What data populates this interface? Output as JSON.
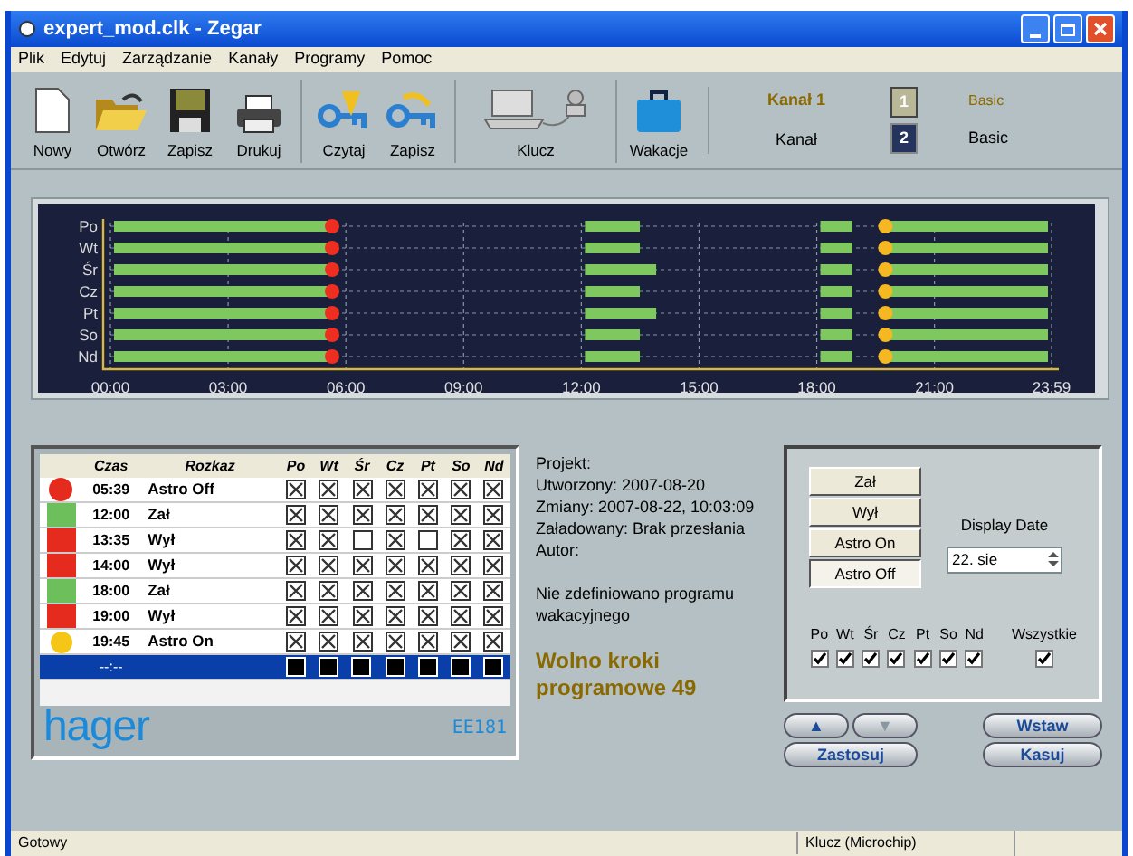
{
  "window": {
    "title": "expert_mod.clk - Zegar"
  },
  "menu": [
    "Plik",
    "Edytuj",
    "Zarządzanie",
    "Kanały",
    "Programy",
    "Pomoc"
  ],
  "toolbar": [
    {
      "label": "Nowy",
      "kind": "new"
    },
    {
      "label": "Otwórz",
      "kind": "open"
    },
    {
      "label": "Zapisz",
      "kind": "save"
    },
    {
      "label": "Drukuj",
      "kind": "print"
    },
    {
      "label": "Czytaj",
      "kind": "key-read"
    },
    {
      "label": "Zapisz",
      "kind": "key-write"
    },
    {
      "label": "Klucz",
      "kind": "computer"
    },
    {
      "label": "Wakacje",
      "kind": "suitcase"
    }
  ],
  "channel": {
    "name": "Kanał 1",
    "label": "Kanał",
    "buttons": [
      {
        "label": "1",
        "selected": true
      },
      {
        "label": "2",
        "selected": false
      }
    ],
    "mode_top": "Basic",
    "mode": "Basic"
  },
  "timeline": {
    "days": [
      "Po",
      "Wt",
      "Śr",
      "Cz",
      "Pt",
      "So",
      "Nd"
    ],
    "ticks": [
      "00:00",
      "03:00",
      "06:00",
      "09:00",
      "12:00",
      "15:00",
      "18:00",
      "21:00",
      "23:59"
    ]
  },
  "table": {
    "columns": [
      "Czas",
      "Rozkaz",
      "Po",
      "Wt",
      "Śr",
      "Cz",
      "Pt",
      "So",
      "Nd"
    ],
    "rows": [
      {
        "kind": "astro-off",
        "time": "05:39",
        "command": "Astro Off",
        "days": [
          true,
          true,
          true,
          true,
          true,
          true,
          true
        ],
        "selected": false
      },
      {
        "kind": "on",
        "time": "12:00",
        "command": "Zał",
        "days": [
          true,
          true,
          true,
          true,
          true,
          true,
          true
        ],
        "selected": false
      },
      {
        "kind": "off",
        "time": "13:35",
        "command": "Wył",
        "days": [
          true,
          true,
          false,
          true,
          false,
          true,
          true
        ],
        "selected": false
      },
      {
        "kind": "off",
        "time": "14:00",
        "command": "Wył",
        "days": [
          true,
          true,
          true,
          true,
          true,
          true,
          true
        ],
        "selected": false
      },
      {
        "kind": "on",
        "time": "18:00",
        "command": "Zał",
        "days": [
          true,
          true,
          true,
          true,
          true,
          true,
          true
        ],
        "selected": false
      },
      {
        "kind": "off",
        "time": "19:00",
        "command": "Wył",
        "days": [
          true,
          true,
          true,
          true,
          true,
          true,
          true
        ],
        "selected": false
      },
      {
        "kind": "astro-on",
        "time": "19:45",
        "command": "Astro On",
        "days": [
          true,
          true,
          true,
          true,
          true,
          true,
          true
        ],
        "selected": false
      },
      {
        "kind": "empty",
        "time": "--:--",
        "selected": true
      }
    ],
    "brand": "hager",
    "model": "EE181"
  },
  "info": {
    "lines": [
      "Projekt:",
      "Utworzony: 2007-08-20",
      "Zmiany: 2007-08-22, 10:03:09",
      "Załadowany: Brak przesłania",
      "Autor:"
    ],
    "note": "Nie zdefiniowano programu wakacyjnego",
    "free_steps": "Wolno kroki programowe 49"
  },
  "commands": [
    {
      "label": "Zał",
      "selected": false
    },
    {
      "label": "Wył",
      "selected": false
    },
    {
      "label": "Astro On",
      "selected": false
    },
    {
      "label": "Astro Off",
      "selected": true
    }
  ],
  "display_date": {
    "label": "Display Date",
    "value": "22. sie"
  },
  "day_checks": [
    {
      "label": "Po",
      "checked": true
    },
    {
      "label": "Wt",
      "checked": true
    },
    {
      "label": "Śr",
      "checked": true
    },
    {
      "label": "Cz",
      "checked": true
    },
    {
      "label": "Pt",
      "checked": true
    },
    {
      "label": "So",
      "checked": true
    },
    {
      "label": "Nd",
      "checked": true
    }
  ],
  "all_check": {
    "label": "Wszystkie",
    "checked": true
  },
  "buttons": [
    {
      "label": "▲",
      "kind": "up"
    },
    {
      "label": "▼",
      "kind": "down"
    },
    {
      "label": "Wstaw",
      "kind": "insert"
    },
    {
      "label": "Zastosuj",
      "kind": "apply"
    },
    {
      "label": "Kasuj",
      "kind": "delete"
    }
  ],
  "status": [
    "Gotowy",
    "Klucz (Microchip)"
  ]
}
